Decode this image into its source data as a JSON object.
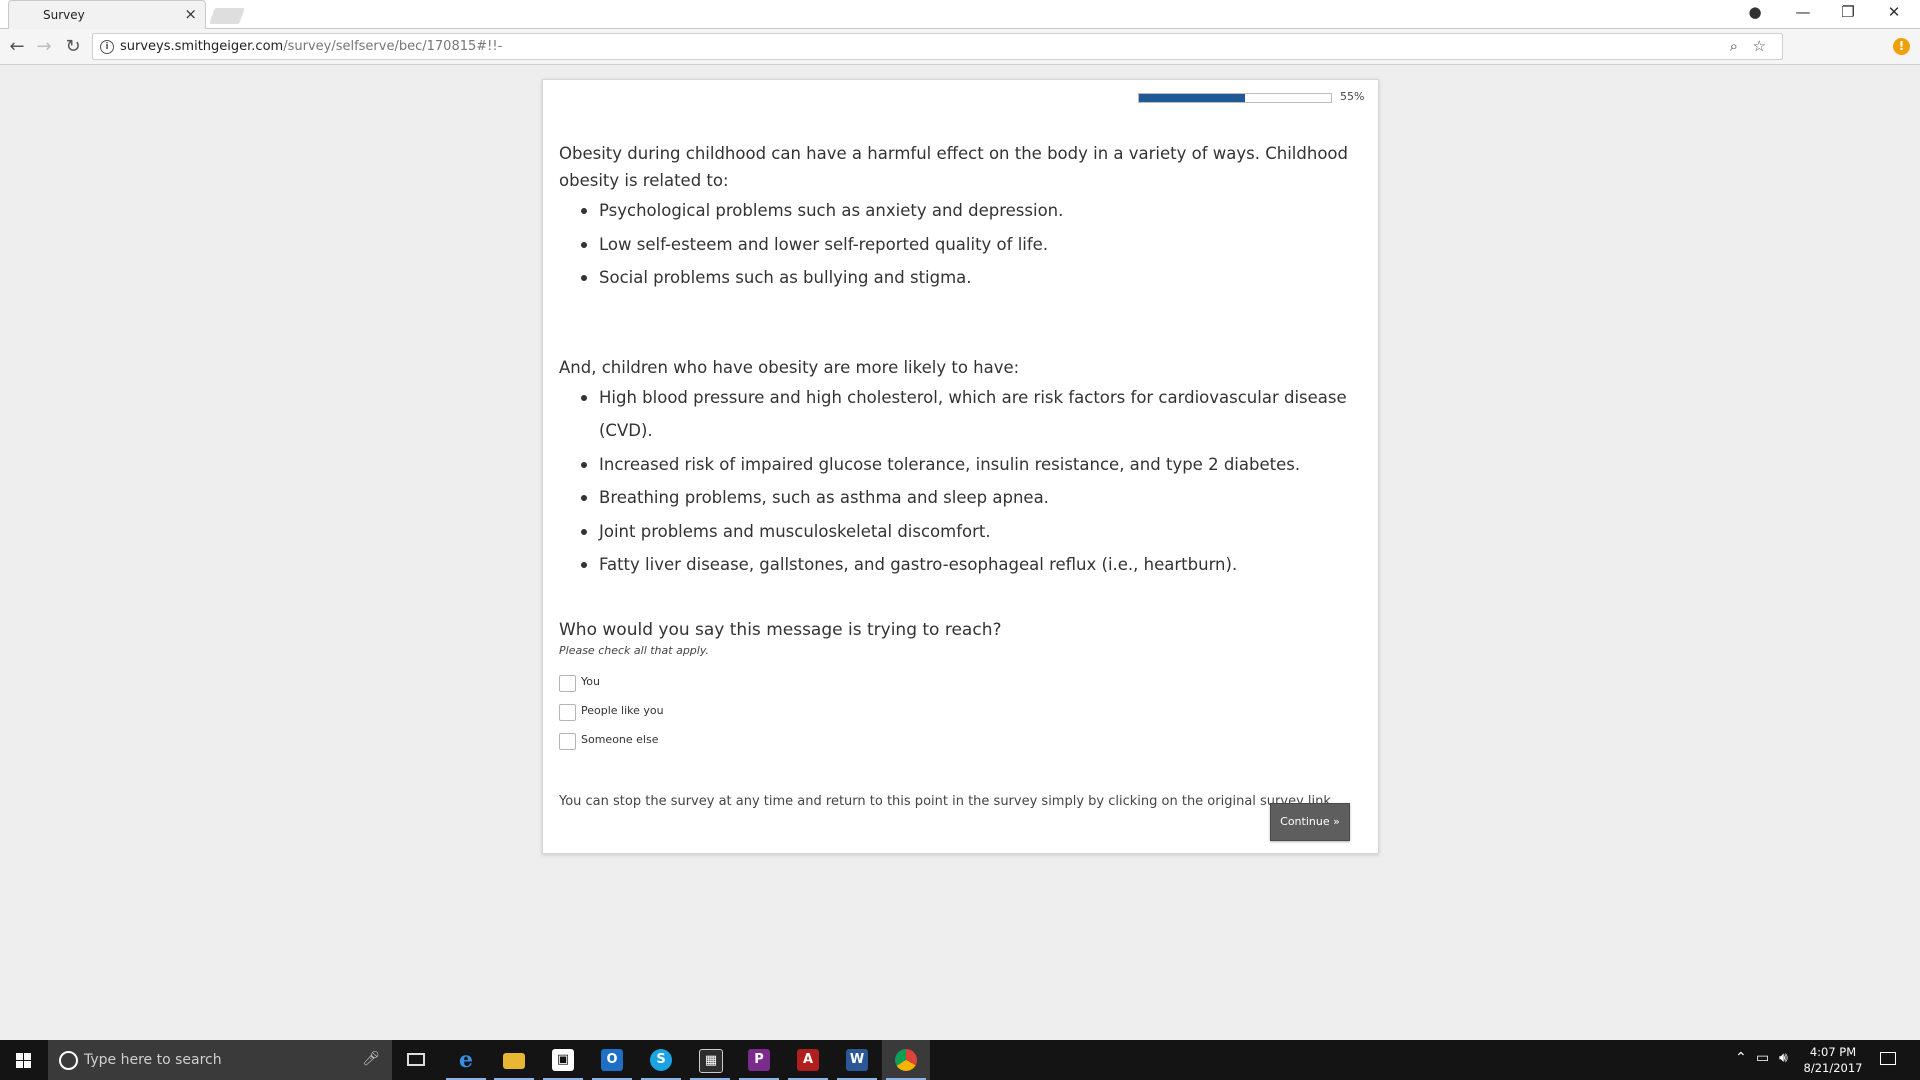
{
  "browser": {
    "tab_title": "Survey",
    "tab_close": "×",
    "url_host": "surveys.smithgeiger.com",
    "url_path": "/survey/selfserve/bec/170815#!!-"
  },
  "survey": {
    "progress_percent": 55,
    "progress_label": "55%",
    "intro": "Obesity during childhood can have a harmful effect on the body in a variety of ways. Childhood obesity is related to:",
    "intro_bullets": [
      "Psychological problems such as anxiety and depression.",
      "Low self-esteem and lower self-reported quality of life.",
      "Social problems such as bullying and stigma."
    ],
    "intro2": "And, children who have obesity are more likely to have:",
    "intro2_bullets": [
      "High blood pressure and high cholesterol, which are risk factors for cardiovascular disease (CVD).",
      "Increased risk of impaired glucose tolerance, insulin resistance, and type 2 diabetes.",
      "Breathing problems, such as asthma and sleep apnea.",
      "Joint problems and musculoskeletal discomfort.",
      "Fatty liver disease, gallstones, and gastro-esophageal reflux (i.e., heartburn)."
    ],
    "question": "Who would you say this message is trying to reach?",
    "instruction": "Please check all that apply.",
    "options": [
      {
        "label": "You",
        "checked": false
      },
      {
        "label": "People like you",
        "checked": false
      },
      {
        "label": "Someone else",
        "checked": false
      }
    ],
    "note": "You can stop the survey at any time and return to this point in the survey simply by clicking on the original survey link.",
    "continue_label": "Continue »"
  },
  "taskbar": {
    "search_placeholder": "Type here to search",
    "time": "4:07 PM",
    "date": "8/21/2017",
    "apps": [
      "edge-icon",
      "file-explorer-icon",
      "store-icon",
      "outlook-icon",
      "skype-icon",
      "calculator-icon",
      "pdf-tool-icon",
      "acrobat-icon",
      "word-icon",
      "chrome-icon"
    ]
  },
  "colors": {
    "progress_fill": "#1f5a96",
    "continue_button": "#5e5e5e",
    "page_background": "#eeeeee",
    "taskbar": "#141414"
  }
}
